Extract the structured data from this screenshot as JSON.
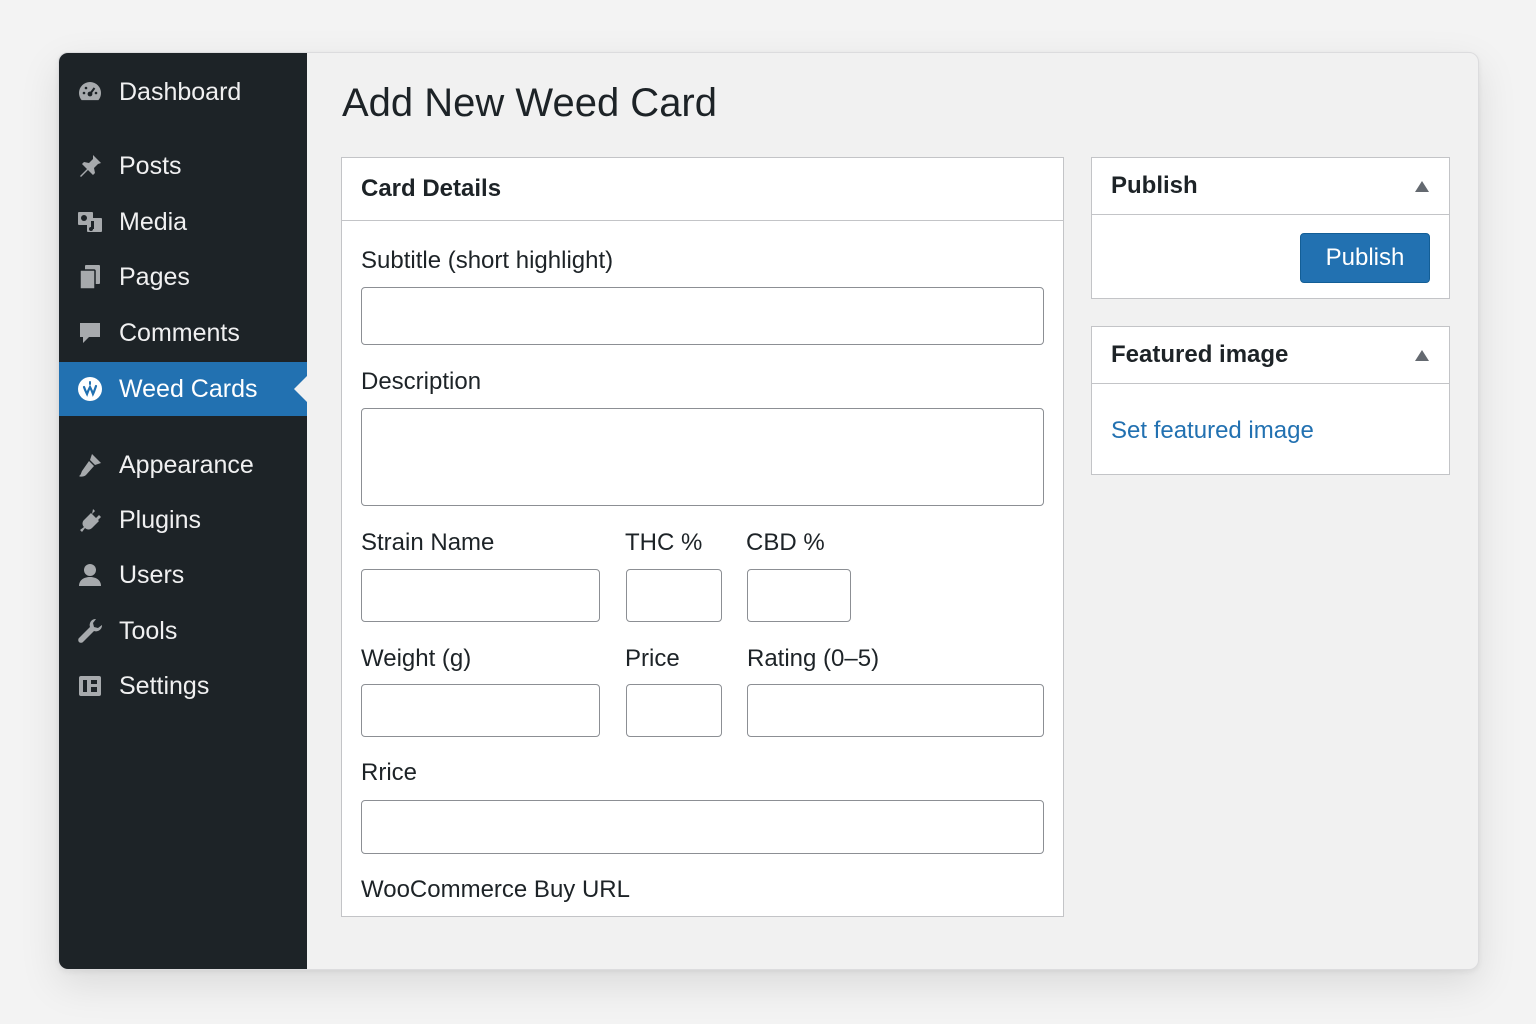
{
  "sidebar": {
    "items": [
      {
        "label": "Dashboard",
        "icon": "dashboard-icon"
      },
      {
        "label": "Posts",
        "icon": "pin-icon"
      },
      {
        "label": "Media",
        "icon": "media-icon"
      },
      {
        "label": "Pages",
        "icon": "pages-icon"
      },
      {
        "label": "Comments",
        "icon": "comment-icon"
      },
      {
        "label": "Weed Cards",
        "icon": "weed-card-icon",
        "active": true
      },
      {
        "label": "Appearance",
        "icon": "brush-icon"
      },
      {
        "label": "Plugins",
        "icon": "plug-icon"
      },
      {
        "label": "Users",
        "icon": "user-icon"
      },
      {
        "label": "Tools",
        "icon": "wrench-icon"
      },
      {
        "label": "Settings",
        "icon": "settings-icon"
      }
    ]
  },
  "page": {
    "title": "Add New Weed Card"
  },
  "card_details": {
    "title": "Card Details",
    "fields": {
      "subtitle": {
        "label": "Subtitle (short highlight)",
        "value": ""
      },
      "description": {
        "label": "Description",
        "value": ""
      },
      "strain_name": {
        "label": "Strain Name",
        "value": ""
      },
      "thc": {
        "label": "THC %",
        "value": ""
      },
      "cbd": {
        "label": "CBD %",
        "value": ""
      },
      "weight": {
        "label": "Weight (g)",
        "value": ""
      },
      "price": {
        "label": "Price",
        "value": ""
      },
      "rating": {
        "label": "Rating (0–5)",
        "value": ""
      },
      "rrice": {
        "label": "Rrice",
        "value": ""
      },
      "buy_url": {
        "label": "WooCommerce Buy URL"
      }
    }
  },
  "publish_box": {
    "title": "Publish",
    "button_label": "Publish"
  },
  "featured_image_box": {
    "title": "Featured image",
    "link_label": "Set featured image"
  },
  "colors": {
    "sidebar_bg": "#1d2327",
    "accent": "#2271b1",
    "page_bg": "#f1f1f1"
  }
}
